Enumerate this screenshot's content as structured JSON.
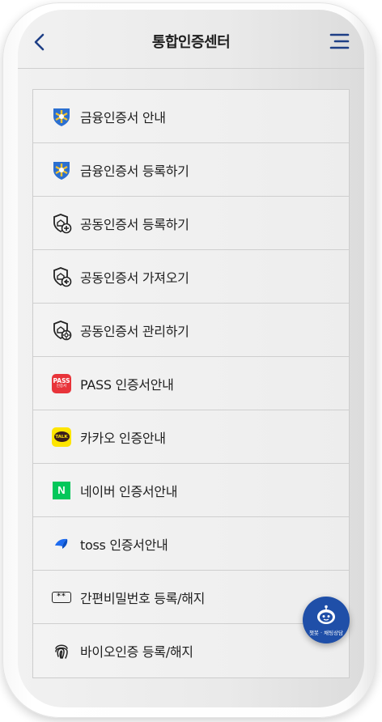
{
  "header": {
    "title": "통합인증센터",
    "back_icon": "chevron-left-icon",
    "menu_icon": "hamburger-menu-icon"
  },
  "menu": {
    "items": [
      {
        "label": "금융인증서 안내",
        "icon": "financial-cert-icon"
      },
      {
        "label": "금융인증서 등록하기",
        "icon": "financial-cert-icon"
      },
      {
        "label": "공동인증서 등록하기",
        "icon": "shield-plus-icon"
      },
      {
        "label": "공동인증서 가져오기",
        "icon": "shield-import-icon"
      },
      {
        "label": "공동인증서 관리하기",
        "icon": "shield-gear-icon"
      },
      {
        "label": "PASS 인증서안내",
        "icon": "pass-logo-icon",
        "icon_text": "PASS",
        "icon_sub": "인증서"
      },
      {
        "label": "카카오 인증안내",
        "icon": "kakao-talk-icon",
        "icon_text": "TALK"
      },
      {
        "label": "네이버 인증서안내",
        "icon": "naver-logo-icon",
        "icon_text": "N"
      },
      {
        "label": "toss 인증서안내",
        "icon": "toss-logo-icon"
      },
      {
        "label": "간편비밀번호 등록/해지",
        "icon": "pin-password-icon",
        "icon_text": "**"
      },
      {
        "label": "바이오인증 등록/해지",
        "icon": "fingerprint-icon"
      }
    ]
  },
  "chatbot": {
    "label": "챗봇 · 채팅상담",
    "icon": "robot-icon"
  },
  "colors": {
    "accent": "#1f4fa8",
    "pass": "#e8343a",
    "kakao": "#fee500",
    "naver": "#03c75a",
    "toss": "#1e6cf0"
  }
}
